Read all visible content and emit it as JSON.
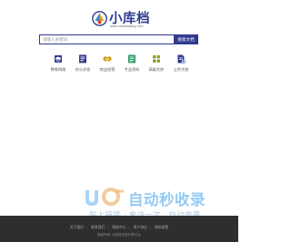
{
  "logo": {
    "title": "小库档",
    "url": "www.xiaokudang.com"
  },
  "search": {
    "placeholder": "请输入关键词",
    "button_label": "搜索文档"
  },
  "categories": [
    {
      "label": "教育网络",
      "icon": "graduation-cap-icon",
      "color": "#2f3b8f"
    },
    {
      "label": "办公文档",
      "icon": "office-document-icon",
      "color": "#2f3b8f"
    },
    {
      "label": "商业经营",
      "icon": "handshake-icon",
      "color": "#d4a017"
    },
    {
      "label": "专业资料",
      "icon": "professional-document-icon",
      "color": "#2a9a6a"
    },
    {
      "label": "高级文库",
      "icon": "grid-icon",
      "color": "#8aa030"
    },
    {
      "label": "上传文档",
      "icon": "upload-document-icon",
      "color": "#2f3b8f"
    }
  ],
  "watermark": {
    "title": "自动秒收录",
    "subtitle": "贴上链接 · 来访一次 · 自动收录"
  },
  "footer": {
    "links": [
      "关于我们",
      "联系我们",
      "帮助中心",
      "用户协议",
      "隐私政策"
    ],
    "copyright": "版权所有 小库档文档分享平台"
  },
  "colors": {
    "brand": "#2f3b8f",
    "footer_bg": "#2e2e2e"
  }
}
